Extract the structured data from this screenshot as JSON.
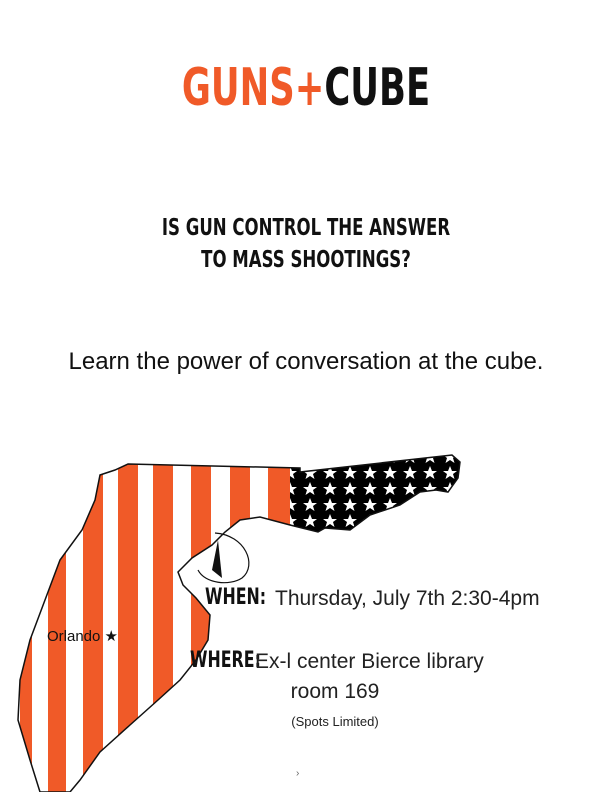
{
  "header": {
    "title_part1": "GUNS+",
    "title_part2": "CUBE"
  },
  "question": {
    "line1": "IS GUN CONTROL THE ANSWER",
    "line2": "TO MASS SHOOTINGS?"
  },
  "tagline": "Learn the power of conversation at the cube.",
  "map": {
    "city_label": "Orlando ★",
    "stripe_color": "#f05a28",
    "field_color": "#000000"
  },
  "event": {
    "when_label": "WHEN:",
    "when_value": "Thursday, July 7th 2:30-4pm",
    "where_label": "WHERE:",
    "where_value": "Ex-l center Bierce library",
    "room": "room 169",
    "note": "(Spots Limited)"
  },
  "footer": {
    "mark": "›"
  }
}
